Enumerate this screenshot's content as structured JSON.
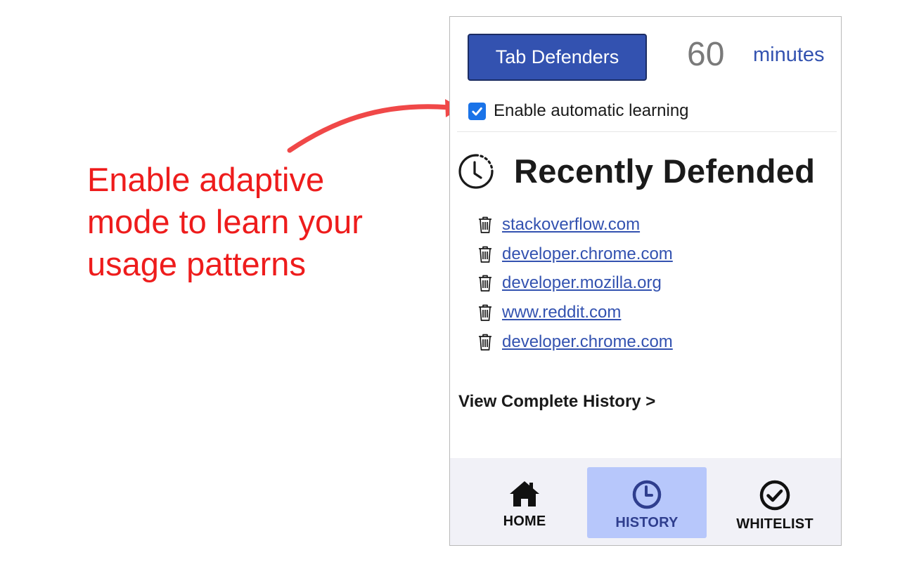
{
  "annotation": {
    "lines": [
      "Enable adaptive",
      "mode to learn your",
      "usage patterns"
    ],
    "color": "#ee1c1c"
  },
  "header": {
    "defend_button_label": "Tab Defenders",
    "timer_value": "60",
    "timer_unit": "minutes"
  },
  "learning": {
    "label": "Enable automatic learning",
    "checked": true
  },
  "section": {
    "title": "Recently Defended",
    "icon": "clock-history-icon"
  },
  "history": {
    "items": [
      {
        "label": "stackoverflow.com"
      },
      {
        "label": "developer.chrome.com"
      },
      {
        "label": "developer.mozilla.org"
      },
      {
        "label": "www.reddit.com"
      },
      {
        "label": "developer.chrome.com"
      }
    ],
    "item_icon": "trash-icon",
    "view_all_label": "View Complete History >"
  },
  "nav": {
    "tabs": [
      {
        "label": "HOME",
        "icon": "home-icon",
        "active": false
      },
      {
        "label": "HISTORY",
        "icon": "clock-icon",
        "active": true
      },
      {
        "label": "WHITELIST",
        "icon": "check-circle-icon",
        "active": false
      }
    ]
  },
  "colors": {
    "accent": "#3352b0",
    "checkbox": "#1a73e8",
    "active_tab": "#b7c7fb"
  }
}
